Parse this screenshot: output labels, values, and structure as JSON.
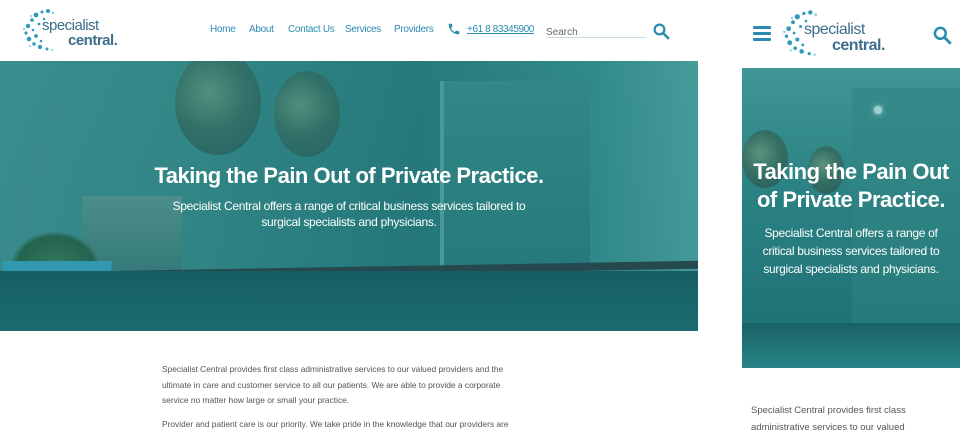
{
  "brand": {
    "name_line1": "specialist",
    "name_line2": "central.",
    "accent_color": "#2a8cb0",
    "logo_text_color": "#3d6e8c"
  },
  "nav": {
    "items": [
      {
        "label": "Home"
      },
      {
        "label": "About"
      },
      {
        "label": "Contact Us"
      },
      {
        "label": "Services"
      },
      {
        "label": "Providers"
      }
    ],
    "phone": "+61 8 83345900"
  },
  "search": {
    "placeholder": "Search"
  },
  "hero": {
    "title": "Taking the Pain Out of Private Practice.",
    "subtitle": "Specialist Central offers a range of critical business services tailored to surgical specialists and physicians."
  },
  "content": {
    "paragraph1": "Specialist Central provides first class administrative services to our valued providers and the ultimate in care and customer service to all our patients. We are able to provide a corporate service no matter how large or small your practice.",
    "paragraph2": "Provider and patient care is our priority. We take pride in the knowledge that our providers are"
  },
  "mobile": {
    "hero_title": "Taking the Pain Out of Private Practice.",
    "hero_subtitle": "Specialist Central offers a range of critical business services tailored to surgical specialists and physicians.",
    "content_text": "Specialist Central provides first class administrative services to our valued"
  }
}
